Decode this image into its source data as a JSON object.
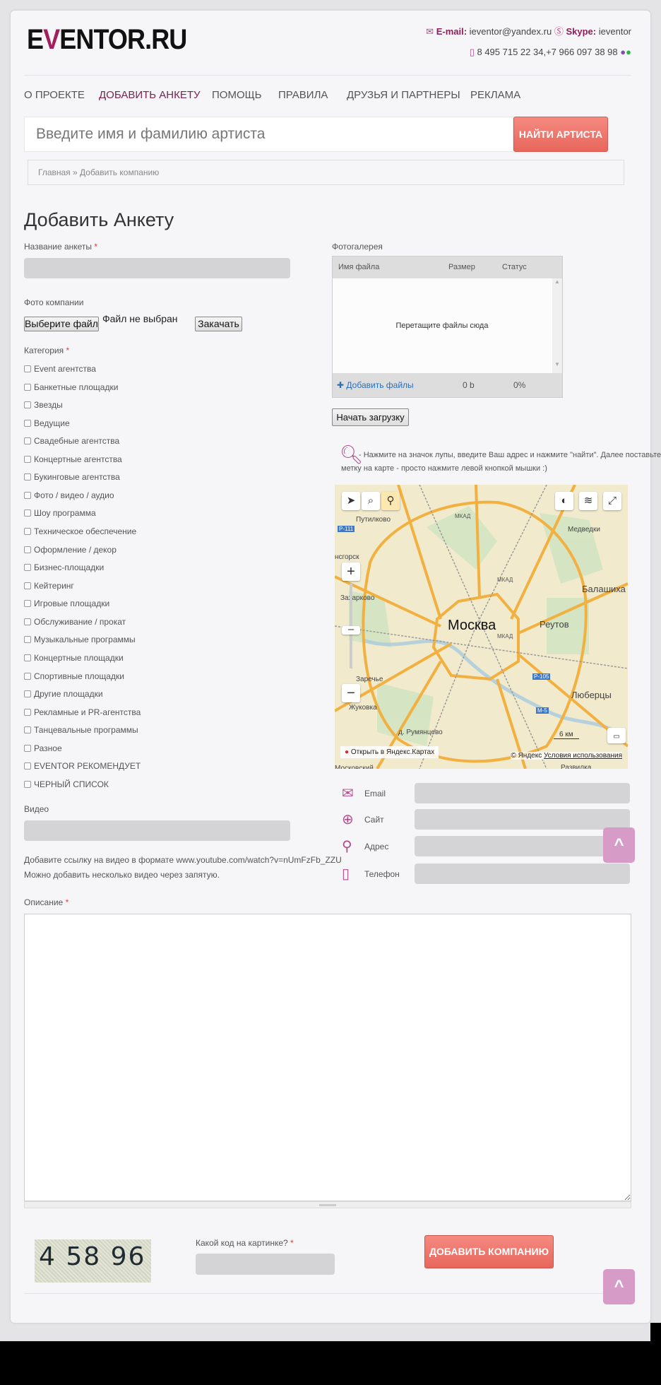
{
  "header": {
    "logo": "EVENTOR.RU",
    "email_label": "E-mail:",
    "email": "ieventor@yandex.ru",
    "skype_label": "Skype:",
    "skype": "ieventor",
    "phones": "8 495 715 22 34,+7 966 097 38 98"
  },
  "nav": [
    {
      "label": "О ПРОЕКТЕ"
    },
    {
      "label": "ДОБАВИТЬ АНКЕТУ",
      "active": true
    },
    {
      "label": "ПОМОЩЬ"
    },
    {
      "label": "ПРАВИЛА"
    },
    {
      "label": "ДРУЗЬЯ И ПАРТНЕРЫ"
    },
    {
      "label": "РЕКЛАМА"
    }
  ],
  "search": {
    "placeholder": "Введите имя и фамилию артиста",
    "button": "НАЙТИ АРТИСТА"
  },
  "breadcrumb": "Главная » Добавить компанию",
  "title": "Добавить Анкету",
  "form": {
    "name_label": "Название анкеты",
    "required": "*",
    "photo_label": "Фото компании",
    "choose_file": "Выберите файл",
    "no_file": "Файл не выбран",
    "upload": "Закачать",
    "category_label": "Категория",
    "categories": [
      "Event агентства",
      "Банкетные площадки",
      "Звезды",
      "Ведущие",
      "Свадебные агентства",
      "Концертные агентства",
      "Букинговые агентства",
      "Фото / видео / аудио",
      "Шоу программа",
      "Техническое обеспечение",
      "Оформление / декор",
      "Бизнес-площадки",
      "Кейтеринг",
      "Игровые площадки",
      "Обслуживание / прокат",
      "Музыкальные программы",
      "Концертные площадки",
      "Спортивные площадки",
      "Другие площадки",
      "Рекламные и PR-агентства",
      "Танцевальные программы",
      "Разное",
      "EVENTOR РЕКОМЕНДУЕТ",
      "ЧЕРНЫЙ СПИСОК"
    ],
    "video_label": "Видео",
    "video_help1": "Добавите ссылку на видео в формате www.youtube.com/watch?v=nUmFzFb_ZZU",
    "video_help2": "Можно добавить несколько видео через запятую.",
    "description_label": "Описание",
    "captcha_code": "4 58 96",
    "captcha_label": "Какой код на картинке?",
    "submit": "ДОБАВИТЬ КОМПАНИЮ"
  },
  "gallery": {
    "label": "Фотогалерея",
    "col_name": "Имя файла",
    "col_size": "Размер",
    "col_status": "Статус",
    "drop": "Перетащите файлы сюда",
    "add": "Добавить файлы",
    "size": "0 b",
    "percent": "0%",
    "start": "Начать загрузку"
  },
  "map": {
    "hint1": "- Нажмите на значок лупы, введите Ваш адрес и нажмите \"найти\". Далее поставьте",
    "hint2": "метку на карте - просто нажмите левой кнопкой мышки :)",
    "city": "Москва",
    "places": [
      "Путилково",
      "Медведки",
      "нсгорск",
      "Балашиха",
      "Захарково",
      "Реутов",
      "Заречье",
      "Люберцы",
      "Жуковка",
      "д. Румянцево",
      "Московский",
      "Развилка"
    ],
    "roads": [
      "МКАД",
      "МКАД",
      "МКАД",
      "Р-111",
      "Р-105",
      "М-5"
    ],
    "scale": "6 км",
    "open": "Открыть в Яндекс.Картах",
    "copyright": "© Яндекс",
    "terms": "Условия использования"
  },
  "contacts": [
    {
      "label": "Email",
      "icon": "envelope-icon"
    },
    {
      "label": "Сайт",
      "icon": "globe-icon"
    },
    {
      "label": "Адрес",
      "icon": "location-pin-icon"
    },
    {
      "label": "Телефон",
      "icon": "phone-icon"
    }
  ],
  "colors": {
    "accent": "#a0205e",
    "button": "#e8665c",
    "totop": "#d69bc6"
  },
  "totop": "^"
}
